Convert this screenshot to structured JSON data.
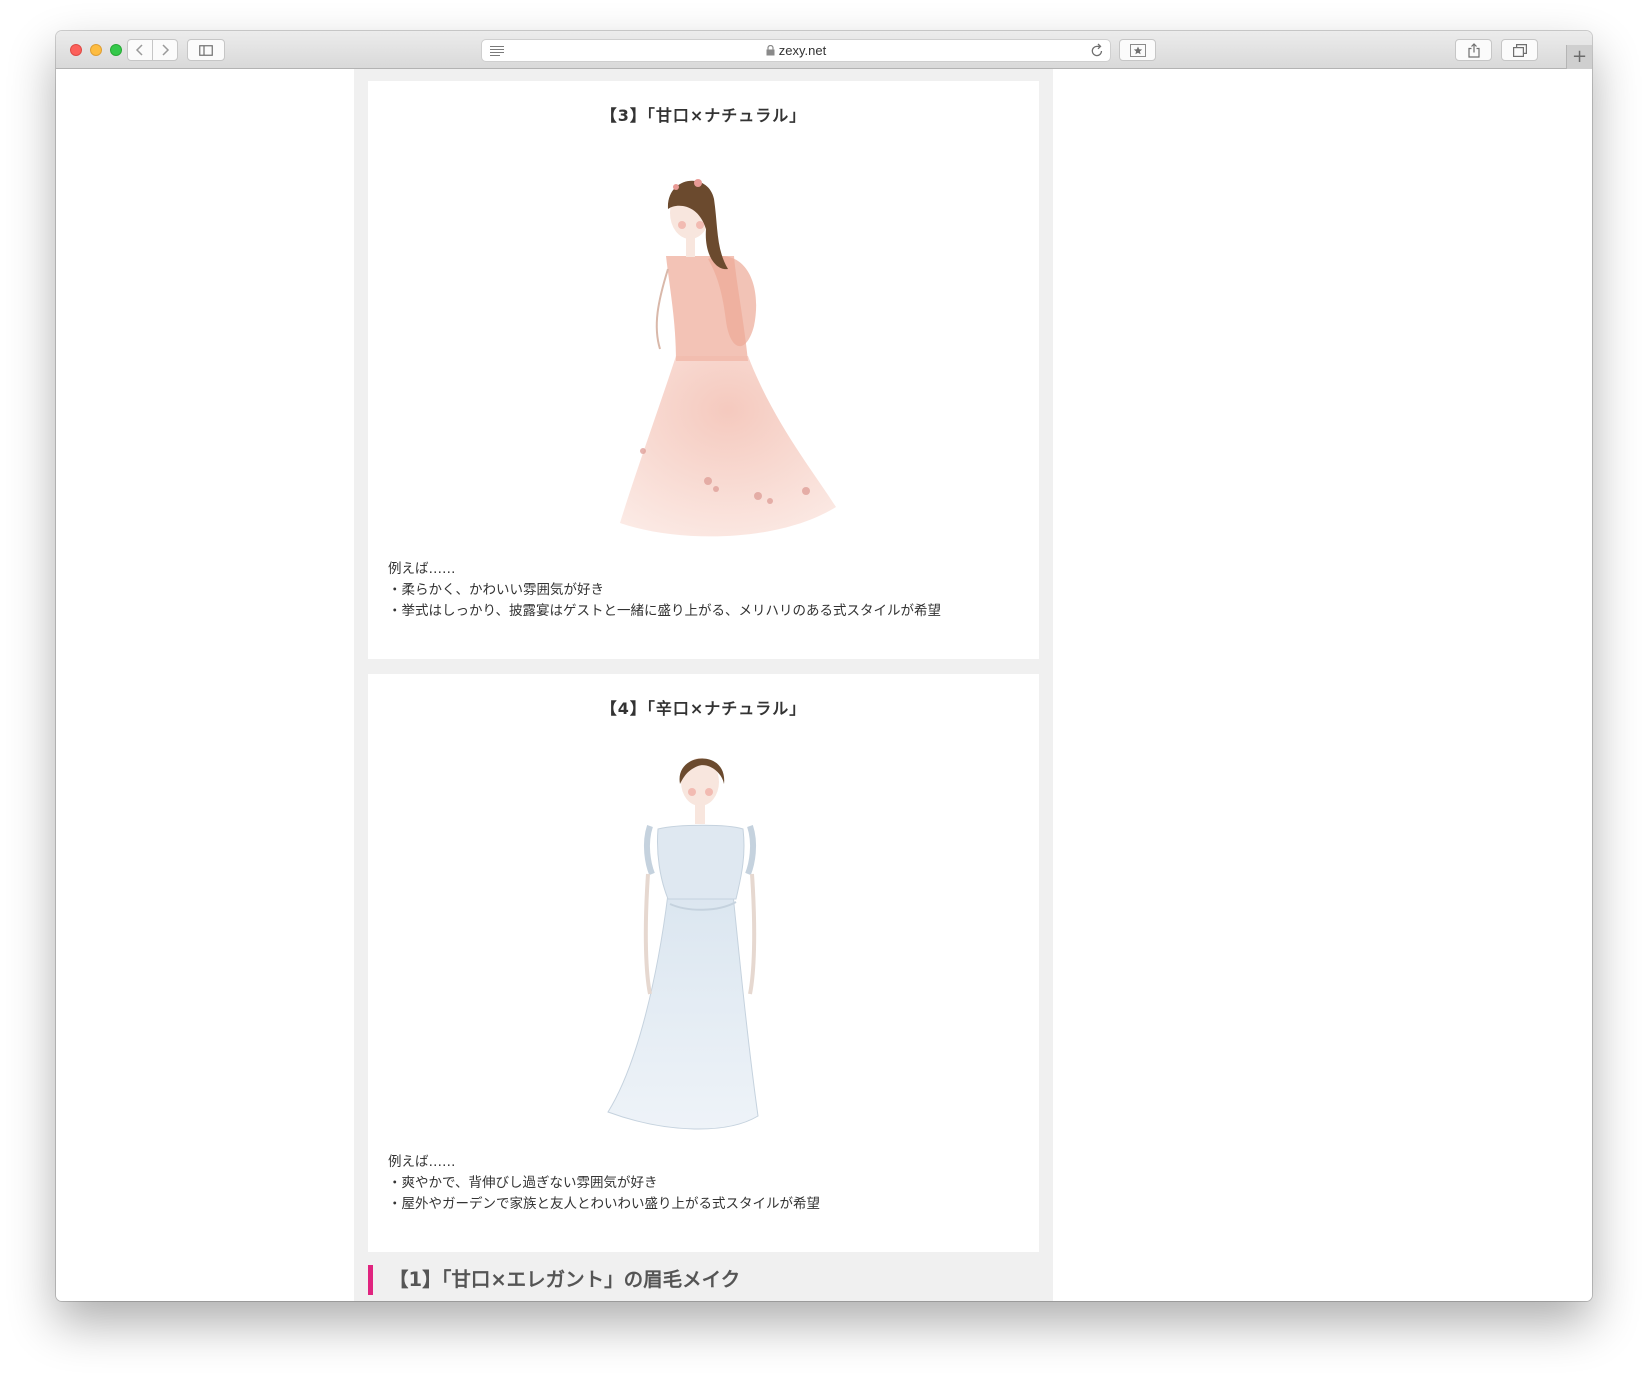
{
  "browser": {
    "url": "zexy.net"
  },
  "cards": [
    {
      "title": "【3】「甘口×ナチュラル」",
      "lead": "例えば……",
      "bullets": [
        "・柔らかく、かわいい雰囲気が好き",
        "・挙式はしっかり、披露宴はゲストと一緒に盛り上がる、メリハリのある式スタイルが希望"
      ],
      "illustration_colors": {
        "dress": "#f6d3c8",
        "hair": "#6b4a2e"
      }
    },
    {
      "title": "【4】「辛口×ナチュラル」",
      "lead": "例えば……",
      "bullets": [
        "・爽やかで、背伸びし過ぎない雰囲気が好き",
        "・屋外やガーデンで家族と友人とわいわい盛り上がる式スタイルが希望"
      ],
      "illustration_colors": {
        "dress": "#e4edf5",
        "hair": "#6b4a2e"
      }
    }
  ],
  "section_heading": "【1】「甘口×エレガント」の眉毛メイク",
  "colors": {
    "accent": "#e0247f",
    "column_bg": "#f0f0f0"
  }
}
